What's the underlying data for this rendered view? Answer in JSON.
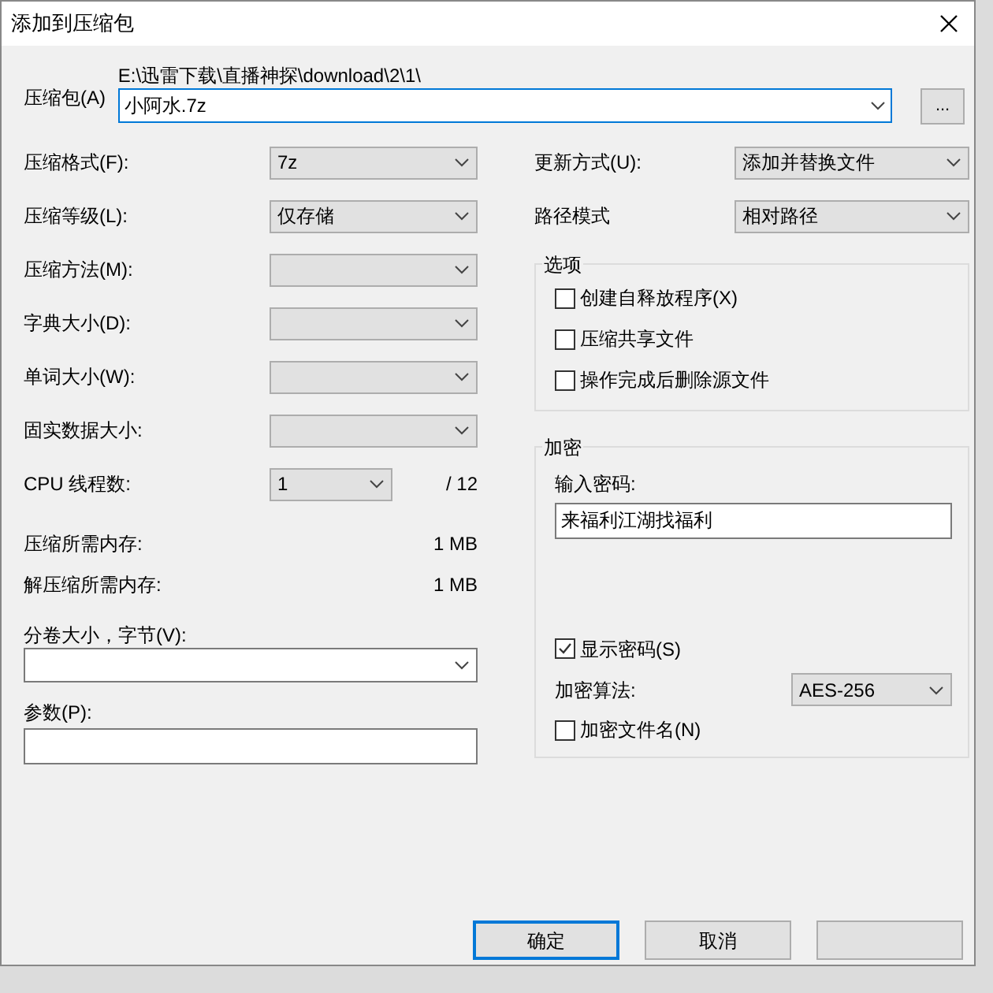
{
  "window": {
    "title": "添加到压缩包"
  },
  "archive": {
    "label": "压缩包(A)",
    "path": "E:\\迅雷下载\\直播神探\\download\\2\\1\\",
    "value": "小阿水.7z",
    "browse": "..."
  },
  "left_fields": [
    {
      "kind": "combo",
      "label": "压缩格式(F):",
      "value": "7z"
    },
    {
      "kind": "combo",
      "label": "压缩等级(L):",
      "value": "仅存储"
    },
    {
      "kind": "combo",
      "label": "压缩方法(M):"
    },
    {
      "kind": "combo",
      "label": "字典大小(D):"
    },
    {
      "kind": "combo",
      "label": "单词大小(W):"
    },
    {
      "kind": "combo",
      "label": "固实数据大小:"
    },
    {
      "kind": "threads",
      "label": "CPU 线程数:",
      "value": "1",
      "total": "/ 12"
    },
    {
      "kind": "info",
      "label": "压缩所需内存:",
      "value": "1 MB"
    },
    {
      "kind": "info",
      "label": "解压缩所需内存:",
      "value": "1 MB"
    }
  ],
  "volume": {
    "label": "分卷大小，字节(V):"
  },
  "params": {
    "label": "参数(P):"
  },
  "right_fields": [
    {
      "label": "更新方式(U):",
      "value": "添加并替换文件"
    },
    {
      "label": "路径模式",
      "value": "相对路径"
    }
  ],
  "options": {
    "title": "选项",
    "items": [
      {
        "label": "创建自释放程序(X)",
        "checked": false
      },
      {
        "label": "压缩共享文件",
        "checked": false
      },
      {
        "label": "操作完成后删除源文件",
        "checked": false
      }
    ]
  },
  "encryption": {
    "title": "加密",
    "password_label": "输入密码:",
    "password": "来福利江湖找福利",
    "show_password": {
      "label": "显示密码(S)",
      "checked": true
    },
    "method_label": "加密算法:",
    "method": "AES-256",
    "encrypt_names": {
      "label": "加密文件名(N)",
      "checked": false
    }
  },
  "buttons": [
    {
      "label": "确定",
      "selected": true
    },
    {
      "label": "取消",
      "selected": false
    }
  ]
}
